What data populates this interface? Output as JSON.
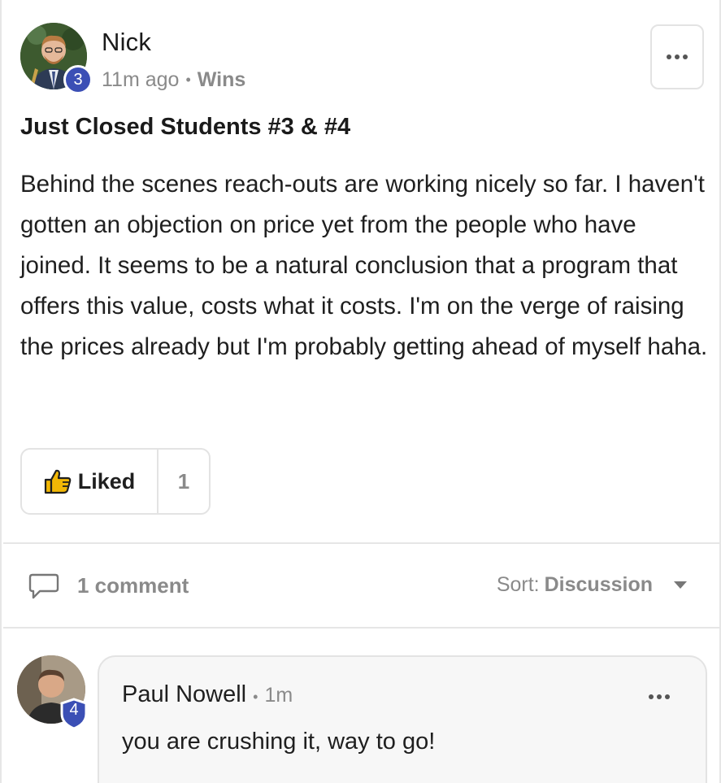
{
  "post": {
    "author": "Nick",
    "level": "3",
    "time": "11m ago",
    "separator": "•",
    "category": "Wins",
    "title": "Just Closed Students #3 & #4",
    "body": "Behind the scenes reach-outs are working nicely so far. I haven't gotten an objection on price yet from the people who have joined. It seems to be a natural conclusion that a program that offers this value, costs what it costs. I'm on the verge of raising the prices already but I'm probably getting ahead of myself haha."
  },
  "like": {
    "label": "Liked",
    "count": "1"
  },
  "comments_bar": {
    "count_label": "1 comment",
    "sort_label": "Sort:",
    "sort_value": "Discussion"
  },
  "comment": {
    "author": "Paul Nowell",
    "separator": "•",
    "time": "1m",
    "level": "4",
    "text": "you are crushing it, way to go!"
  },
  "colors": {
    "level_badge": "#3b4fb5",
    "like_icon": "#f2b705",
    "muted_text": "#8a8a8a",
    "border": "#e3e3e3"
  },
  "icons": [
    "more-icon",
    "thumbs-up-icon",
    "comment-icon",
    "chevron-down-icon",
    "shield-badge-icon"
  ]
}
